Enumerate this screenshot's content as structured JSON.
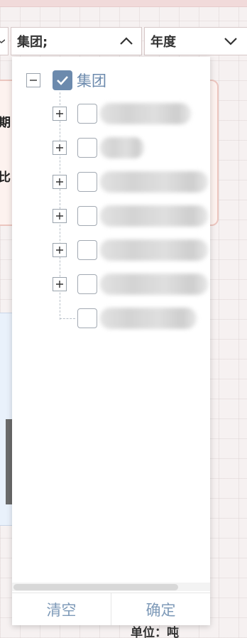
{
  "header": {
    "group_select": {
      "label": "集团;",
      "icon": "chevron-up-icon",
      "open": true
    },
    "year_select": {
      "label": "年度",
      "icon": "chevron-down-icon"
    }
  },
  "background": {
    "text_qi": "期",
    "text_bi": "比",
    "unit_label": "单位：吨"
  },
  "tree": {
    "root": {
      "label": "集团",
      "checked": true,
      "expanded": true
    },
    "children": [
      {
        "has_expander": true,
        "checked": false
      },
      {
        "has_expander": true,
        "checked": false
      },
      {
        "has_expander": true,
        "checked": false
      },
      {
        "has_expander": true,
        "checked": false
      },
      {
        "has_expander": true,
        "checked": false
      },
      {
        "has_expander": true,
        "checked": false
      },
      {
        "has_expander": false,
        "checked": false
      }
    ]
  },
  "footer": {
    "clear_label": "清空",
    "confirm_label": "确定"
  },
  "colors": {
    "accent": "#6c8aad",
    "button_text": "#7e9ab8",
    "card_border": "#ecc6bf"
  }
}
